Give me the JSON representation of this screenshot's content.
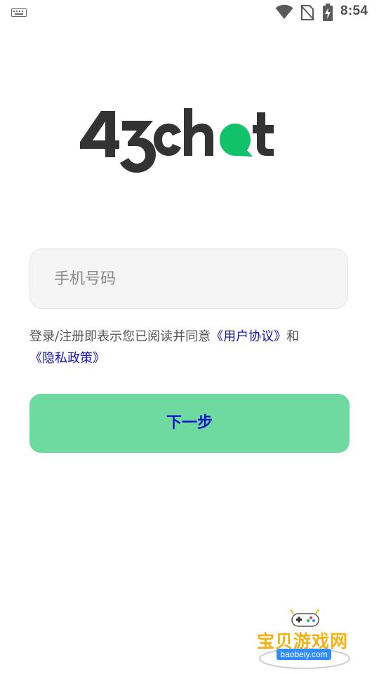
{
  "status_bar": {
    "time": "8:54",
    "icons": [
      "keyboard-icon",
      "wifi-icon",
      "no-sim-icon",
      "battery-charging-icon"
    ]
  },
  "logo": {
    "text": "43chat",
    "colors": {
      "dark": "#333333",
      "accent": "#12c26b"
    }
  },
  "login": {
    "phone_placeholder": "手机号码",
    "phone_value": "",
    "agreement_prefix": "登录/注册即表示您已阅读并同意",
    "user_agreement_link": "《用户协议》",
    "agreement_and": "和",
    "privacy_policy_link": "《隐私政策》",
    "next_button_label": "下一步"
  },
  "watermark": {
    "title": "宝贝游戏网",
    "domain": "baobeiy.com"
  },
  "colors": {
    "button_bg": "#6fdaa0",
    "button_text": "#1414c8",
    "link": "#1212b0",
    "input_bg": "#f5f5f5"
  }
}
